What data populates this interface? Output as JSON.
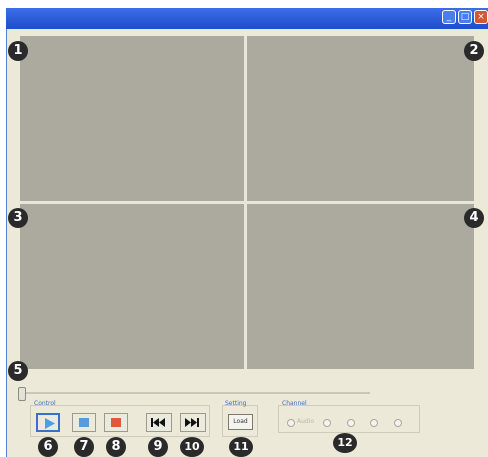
{
  "window": {
    "controls": {
      "minimize": "_",
      "maximize": "□",
      "close": "×"
    }
  },
  "markers": {
    "m1": "1",
    "m2": "2",
    "m3": "3",
    "m4": "4",
    "m5": "5",
    "m6": "6",
    "m7": "7",
    "m8": "8",
    "m9": "9",
    "m10": "10",
    "m11": "11",
    "m12": "12"
  },
  "speed_marks": [
    "",
    "",
    "",
    ""
  ],
  "control": {
    "label": "Control",
    "buttons": [
      {
        "name": "play",
        "icon": "play-icon",
        "active": true,
        "color": "#4aa0e8"
      },
      {
        "name": "pause",
        "icon": "pause-icon",
        "color": "#5a9ad8"
      },
      {
        "name": "stop",
        "icon": "stop-icon",
        "color": "#e2583a"
      },
      {
        "name": "previous",
        "icon": "skip-back-icon",
        "color": "#111111"
      },
      {
        "name": "next",
        "icon": "skip-forward-icon",
        "color": "#111111"
      }
    ]
  },
  "setting": {
    "label": "Setting",
    "load_label": "Load"
  },
  "channel": {
    "label": "Channel",
    "audio_label": "Audio",
    "channels": [
      "",
      "",
      "",
      ""
    ]
  }
}
